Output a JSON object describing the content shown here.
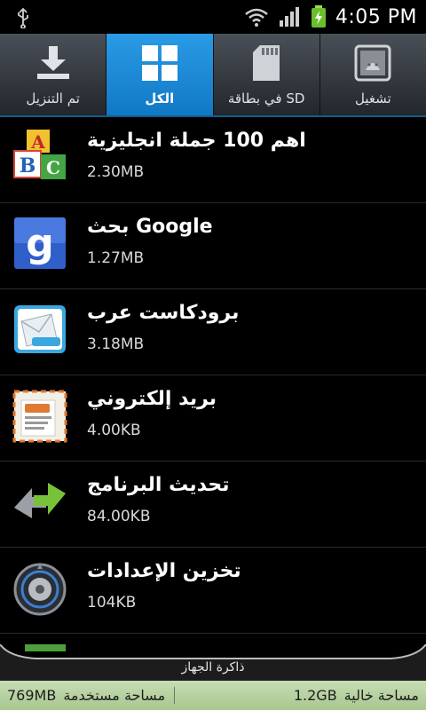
{
  "status": {
    "time": "4:05 PM",
    "icons": [
      "usb-icon",
      "wifi-icon",
      "signal-icon",
      "battery-charging-icon"
    ]
  },
  "tabs": [
    {
      "label": "تم التنزيل",
      "icon": "download-icon",
      "active": false
    },
    {
      "label": "الكل",
      "icon": "grid-icon",
      "active": true
    },
    {
      "label": "في بطاقة SD",
      "icon": "sd-card-icon",
      "active": false
    },
    {
      "label": "تشغيل",
      "icon": "running-apps-icon",
      "active": false
    }
  ],
  "apps": [
    {
      "name": "اهم 100 جملة انجليزية",
      "size": "2.30MB",
      "icon": "abc-blocks-icon"
    },
    {
      "name": "بحث Google",
      "size": "1.27MB",
      "icon": "google-search-icon"
    },
    {
      "name": "برودكاست عرب",
      "size": "3.18MB",
      "icon": "broadcast-arab-icon"
    },
    {
      "name": "بريد إلكتروني",
      "size": "4.00KB",
      "icon": "email-icon"
    },
    {
      "name": "تحديث البرنامج",
      "size": "84.00KB",
      "icon": "software-update-icon"
    },
    {
      "name": "تخزين الإعدادات",
      "size": "104KB",
      "icon": "settings-storage-icon"
    }
  ],
  "storage": {
    "title": "ذاكرة الجهاز",
    "used_label": "مساحة مستخدمة",
    "used_value": "769MB",
    "free_label": "مساحة خالية",
    "free_value": "1.2GB"
  },
  "colors": {
    "tab_active": "#1e8fdc",
    "footer_bg": "#b9d4a2",
    "accent_green": "#7cc243"
  }
}
